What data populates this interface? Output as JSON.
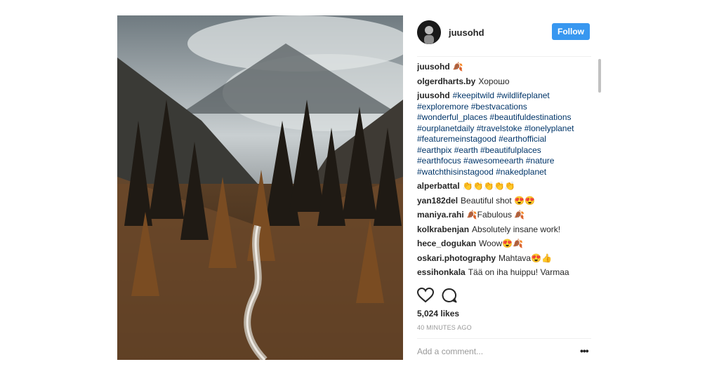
{
  "post": {
    "username": "juusohd",
    "follow_label": "Follow",
    "comments": [
      {
        "user": "juusohd",
        "text": "🍂"
      },
      {
        "user": "olgerdharts.by",
        "text": "Хорошо"
      },
      {
        "user": "juusohd",
        "text": "#keepitwild #wildlifeplanet #exploremore #bestvacations #wonderful_places #beautifuldestinations #ourplanetdaily #travelstoke #lonelyplanet #featuremeinstagood #earthofficial #earthpix #earth #beautifulplaces #earthfocus #awesomeearth #nature #watchthisinstagood #nakedplanet"
      },
      {
        "user": "alperbattal",
        "text": "👏👏👏👏👏"
      },
      {
        "user": "yan182del",
        "text": "Beautiful shot 😍😍"
      },
      {
        "user": "maniya.rahi",
        "text": "🍂Fabulous 🍂"
      },
      {
        "user": "kolkrabenjan",
        "text": "Absolutely insane work!"
      },
      {
        "user": "hece_dogukan",
        "text": "Woow😍🍂"
      },
      {
        "user": "oskari.photography",
        "text": "Mahtava😍👍"
      },
      {
        "user": "essihonkala",
        "text": "Tää on iha huippu! Varmaa"
      }
    ],
    "likes": "5,024 likes",
    "time": "40 MINUTES AGO",
    "comment_placeholder": "Add a comment...",
    "more_icon": "•••"
  }
}
